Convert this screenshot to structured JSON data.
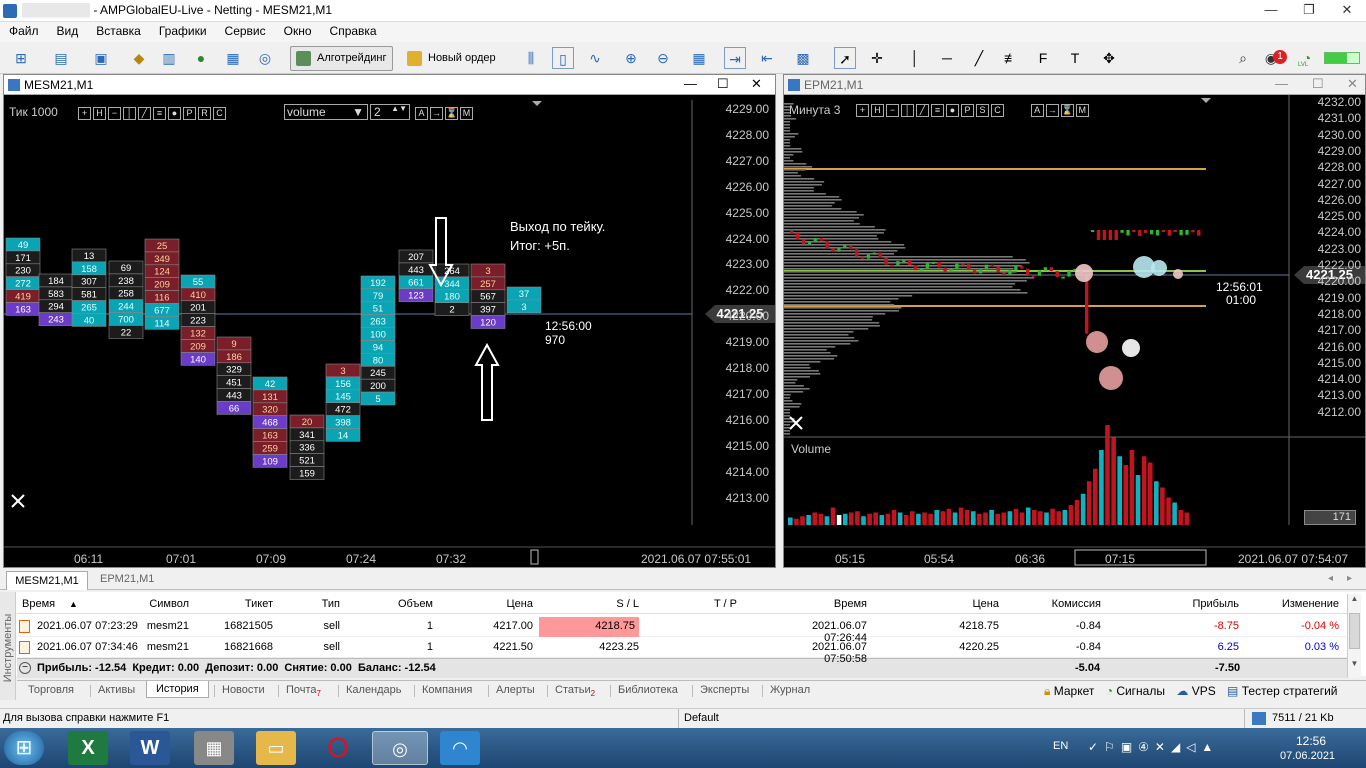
{
  "window": {
    "title_prefix": "████████",
    "title": "- AMPGlobalEU-Live - Netting - MESM21,M1",
    "min": "—",
    "restore": "❐",
    "close": "✕"
  },
  "menu": [
    "Файл",
    "Вид",
    "Вставка",
    "Графики",
    "Сервис",
    "Окно",
    "Справка"
  ],
  "toolbar": {
    "algo_label": "Алготрейдинг",
    "order_label": "Новый ордер",
    "notif_count": "1",
    "lvl": "LVL"
  },
  "chart_left": {
    "name": "MESM21,M1",
    "tf_label": "Тик",
    "tf_value": "1000",
    "select": "volume",
    "spin": "2",
    "prices": [
      "4229.00",
      "4228.00",
      "4227.00",
      "4226.00",
      "4225.00",
      "4224.00",
      "4223.00",
      "4222.00",
      "4221.25",
      "4220.00",
      "4219.00",
      "4218.00",
      "4217.00",
      "4216.00",
      "4215.00",
      "4214.00",
      "4213.00"
    ],
    "current_price": "4221.25",
    "annot_line1": "Выход по тейку.",
    "annot_line2": "Итог: +5п.",
    "time_top": "12:56:00",
    "time_bottom": "970",
    "times": [
      "06:11",
      "07:01",
      "07:09",
      "07:24",
      "07:32"
    ],
    "date": "2021.06.07 07:55:01"
  },
  "chart_right": {
    "name": "EPM21,M1",
    "tf_label": "Минута",
    "tf_value": "3",
    "prices": [
      "4232.00",
      "4231.00",
      "4230.00",
      "4229.00",
      "4228.00",
      "4227.00",
      "4226.00",
      "4225.00",
      "4224.00",
      "4223.00",
      "4222.00",
      "4221.25",
      "4220.00",
      "4219.00",
      "4218.00",
      "4217.00",
      "4216.00",
      "4215.00",
      "4214.00",
      "4213.00",
      "4212.00"
    ],
    "current_price": "4221.25",
    "time_top": "12:56:01",
    "time_bottom": "01:00",
    "volume_label": "Volume",
    "volume_value": "171",
    "times": [
      "05:15",
      "05:54",
      "06:36",
      "07:15"
    ],
    "date": "2021.06.07 07:54:07"
  },
  "chart_tabs": [
    "MESM21,M1",
    "EPM21,M1"
  ],
  "table": {
    "headers": [
      "Время",
      "Символ",
      "Тикет",
      "Тип",
      "Объем",
      "Цена",
      "S / L",
      "T / P",
      "Время",
      "Цена",
      "Комиссия",
      "Прибыль",
      "Изменение"
    ],
    "rows": [
      [
        "2021.06.07 07:23:29",
        "mesm21",
        "16821505",
        "sell",
        "1",
        "4217.00",
        "4218.75",
        "",
        "2021.06.07 07:26:44",
        "4218.75",
        "-0.84",
        "-8.75",
        "-0.04 %"
      ],
      [
        "2021.06.07 07:34:46",
        "mesm21",
        "16821668",
        "sell",
        "1",
        "4221.50",
        "4223.25",
        "",
        "2021.06.07 07:50:58",
        "4220.25",
        "-0.84",
        "6.25",
        "0.03 %"
      ]
    ],
    "summary": "Прибыль: -12.54  Кредит: 0.00  Депозит: 0.00  Снятие: 0.00  Баланс: -12.54",
    "summary_commission": "-5.04",
    "summary_profit": "-7.50",
    "side_label": "Инструменты"
  },
  "bottom_tabs": [
    "Торговля",
    "Активы",
    "История",
    "Новости",
    "Почта",
    "Календарь",
    "Компания",
    "Алерты",
    "Статьи",
    "Библиотека",
    "Эксперты",
    "Журнал"
  ],
  "mail_badge": "7",
  "articles_badge": "2",
  "right_links": [
    "Маркет",
    "Сигналы",
    "VPS",
    "Тестер стратегий"
  ],
  "status": {
    "help": "Для вызова справки нажмите F1",
    "profile": "Default",
    "traffic": "7511 / 21 Kb"
  },
  "tray": {
    "lang": "EN",
    "time": "12:56",
    "date": "07.06.2021"
  },
  "colors": {
    "sell_red": "#e00000",
    "buy_blue": "#0000e0",
    "sl_bg": "#ff9999",
    "cyan": "#00bcd4",
    "bar_red": "#c2141e"
  }
}
